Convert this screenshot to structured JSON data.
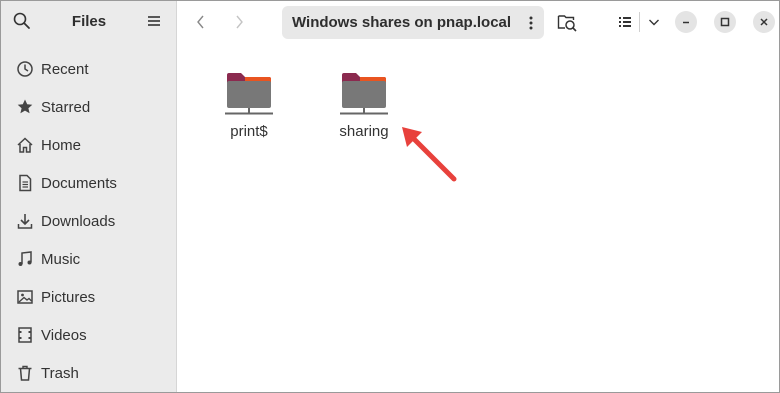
{
  "sidebar": {
    "title": "Files",
    "items": [
      {
        "label": "Recent",
        "icon": "clock-icon"
      },
      {
        "label": "Starred",
        "icon": "star-icon"
      },
      {
        "label": "Home",
        "icon": "home-icon"
      },
      {
        "label": "Documents",
        "icon": "document-icon"
      },
      {
        "label": "Downloads",
        "icon": "download-icon"
      },
      {
        "label": "Music",
        "icon": "music-icon"
      },
      {
        "label": "Pictures",
        "icon": "picture-icon"
      },
      {
        "label": "Videos",
        "icon": "video-icon"
      },
      {
        "label": "Trash",
        "icon": "trash-icon"
      }
    ]
  },
  "header": {
    "location": "Windows shares on pnap.local"
  },
  "files": [
    {
      "name": "print$",
      "type": "network-share-folder"
    },
    {
      "name": "sharing",
      "type": "network-share-folder"
    }
  ],
  "colors": {
    "folder_top": "#8b2a4f",
    "folder_accent": "#e95420",
    "folder_body": "#787878",
    "arrow": "#e8413c",
    "sidebar_bg": "#ebebeb"
  }
}
